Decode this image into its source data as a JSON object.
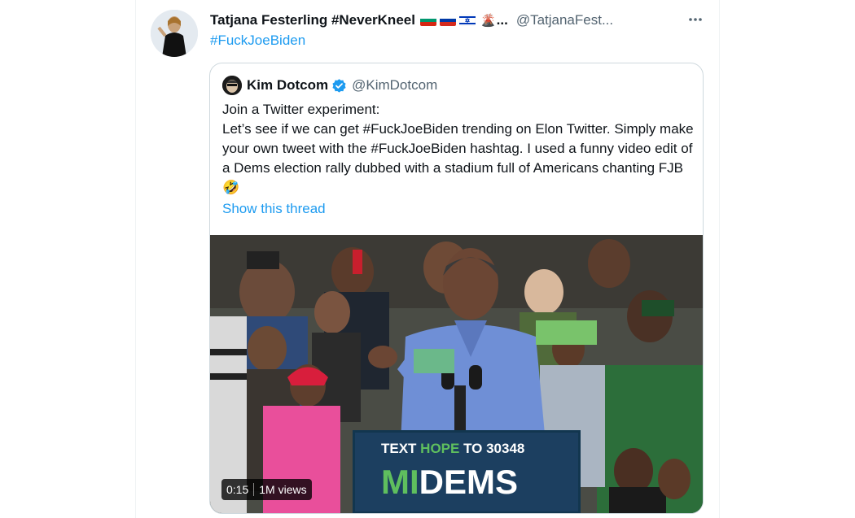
{
  "tweet": {
    "display_name": "Tatjana Festerling #NeverKneel",
    "name_overflow": "...",
    "handle": "@TatjanaFest...",
    "hashtag": "#FuckJoeBiden",
    "flags": [
      "bulgaria-flag",
      "russia-flag",
      "israel-flag"
    ],
    "volcano_emoji": "🌋",
    "more_icon": "more-horizontal-icon"
  },
  "quote": {
    "display_name": "Kim Dotcom",
    "handle": "@KimDotcom",
    "verified_icon": "verified-badge-icon",
    "text_line1": "Join a Twitter experiment:",
    "text_body": "Let’s see if we can get #FuckJoeBiden trending on Elon Twitter. Simply make your own tweet with the #FuckJoeBiden hashtag. I used a funny video edit of a Dems election rally dubbed with a stadium full of Americans chanting FJB 🤣",
    "show_thread": "Show this thread",
    "video": {
      "duration": "0:15",
      "views": "1M views",
      "podium_line1_a": "TEXT ",
      "podium_line1_b": "HOPE",
      "podium_line1_c": " TO 30348",
      "podium_line2_a": "MI",
      "podium_line2_b": "DEMS"
    }
  },
  "colors": {
    "link_blue": "#1d9bf0",
    "secondary_text": "#536471",
    "border": "#cfd9de"
  }
}
